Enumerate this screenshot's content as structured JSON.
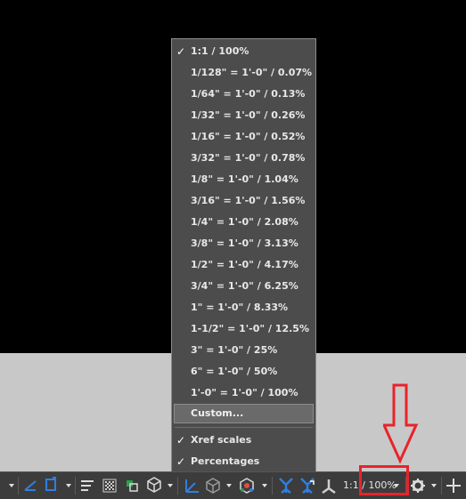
{
  "scale_menu": {
    "items": [
      {
        "label": "1:1 / 100%",
        "checked": true
      },
      {
        "label": "1/128\" = 1'-0\" / 0.07%",
        "checked": false
      },
      {
        "label": "1/64\" = 1'-0\" / 0.13%",
        "checked": false
      },
      {
        "label": "1/32\" = 1'-0\" / 0.26%",
        "checked": false
      },
      {
        "label": "1/16\" = 1'-0\" / 0.52%",
        "checked": false
      },
      {
        "label": "3/32\" = 1'-0\" / 0.78%",
        "checked": false
      },
      {
        "label": "1/8\" = 1'-0\" / 1.04%",
        "checked": false
      },
      {
        "label": "3/16\" = 1'-0\" / 1.56%",
        "checked": false
      },
      {
        "label": "1/4\" = 1'-0\" / 2.08%",
        "checked": false
      },
      {
        "label": "3/8\" = 1'-0\" / 3.13%",
        "checked": false
      },
      {
        "label": "1/2\" = 1'-0\" / 4.17%",
        "checked": false
      },
      {
        "label": "3/4\" = 1'-0\" / 6.25%",
        "checked": false
      },
      {
        "label": "1\" = 1'-0\" / 8.33%",
        "checked": false
      },
      {
        "label": "1-1/2\" = 1'-0\" / 12.5%",
        "checked": false
      },
      {
        "label": "3\" = 1'-0\" / 25%",
        "checked": false
      },
      {
        "label": "6\" = 1'-0\" / 50%",
        "checked": false
      },
      {
        "label": "1'-0\" = 1'-0\" / 100%",
        "checked": false
      }
    ],
    "custom_label": "Custom...",
    "options": [
      {
        "label": "Xref scales",
        "checked": true
      },
      {
        "label": "Percentages",
        "checked": true
      }
    ],
    "check_glyph": "✓"
  },
  "statusbar": {
    "annotation_scale": "1:1 / 100%"
  },
  "colors": {
    "menu_bg": "#4c4c4c",
    "statusbar_bg": "#3c3c3c",
    "accent_blue": "#2f7fe0",
    "highlight_red": "#e8232b"
  }
}
